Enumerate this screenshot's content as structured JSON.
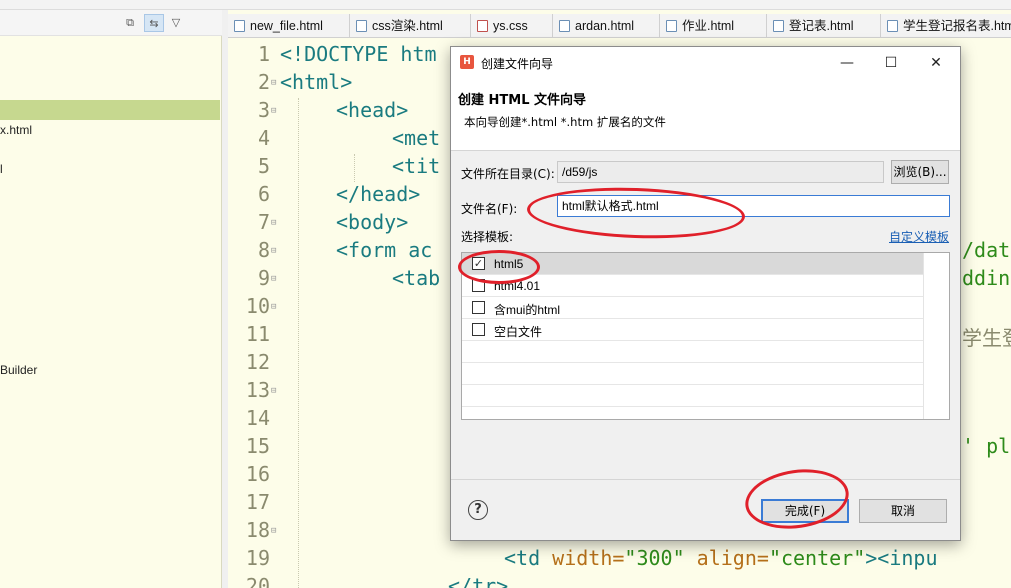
{
  "left_panel": {
    "toolbar_icons": [
      "collapse-icon",
      "link-editor-icon",
      "view-menu-icon"
    ],
    "items": [
      {
        "text": "x.html"
      },
      {
        "text": "l"
      },
      {
        "text": "Builder"
      }
    ]
  },
  "tabs": [
    {
      "label": "new_file.html",
      "icon": "html-file-icon"
    },
    {
      "label": "css渲染.html",
      "icon": "html-file-icon"
    },
    {
      "label": "ys.css",
      "icon": "css-file-icon"
    },
    {
      "label": "ardan.html",
      "icon": "html-file-icon"
    },
    {
      "label": "作业.html",
      "icon": "html-file-icon"
    },
    {
      "label": "登记表.html",
      "icon": "html-file-icon"
    },
    {
      "label": "学生登记报名表.htm",
      "icon": "html-file-icon"
    }
  ],
  "editor": {
    "line_numbers": [
      "1",
      "2",
      "3",
      "4",
      "5",
      "6",
      "7",
      "8",
      "9",
      "10",
      "11",
      "12",
      "13",
      "14",
      "15",
      "16",
      "17",
      "18",
      "19",
      "20"
    ],
    "lines": {
      "l1": "<!DOCTYPE htm",
      "l2": "<html>",
      "l3": "<head>",
      "l4": "<met",
      "l5": "<tit",
      "l6": "</head>",
      "l7": "<body>",
      "l8_tag": "<form ac",
      "l8_right": "/data",
      "l9_tag": "<tab",
      "l9_right": "dding",
      "l11_right": "学生登",
      "l15_right": "' pla",
      "l19_tag_open": "<td ",
      "l19_attr1": "width=",
      "l19_val1": "\"300\"",
      "l19_attr2": " align=",
      "l19_val2": "\"center\"",
      "l19_tag_close": "><inpu",
      "l20": "</tr>"
    }
  },
  "dialog": {
    "window_title": "创建文件向导",
    "app_icon_letter": "H",
    "minimize": "—",
    "maximize": "☐",
    "close": "✕",
    "header_title": "创建 HTML 文件向导",
    "header_desc": "本向导创建*.html *.htm 扩展名的文件",
    "dir_label": "文件所在目录(C):",
    "dir_value": "/d59/js",
    "browse_button": "浏览(B)...",
    "filename_label": "文件名(F):",
    "filename_value": "html默认格式.html",
    "template_label": "选择模板:",
    "custom_template_link": "自定义模板",
    "templates": [
      {
        "label": "html5",
        "checked": true
      },
      {
        "label": "html4.01",
        "checked": false
      },
      {
        "label": "含mui的html",
        "checked": false
      },
      {
        "label": "空白文件",
        "checked": false
      }
    ],
    "help_symbol": "?",
    "finish_button": "完成(F)",
    "cancel_button": "取消"
  },
  "colors": {
    "annotation": "#e0202a",
    "editor_bg": "#fdfde9",
    "selection_green": "#c6d88f",
    "tag": "#1a7b80",
    "attr": "#b5701a",
    "string": "#2e8b1a"
  }
}
